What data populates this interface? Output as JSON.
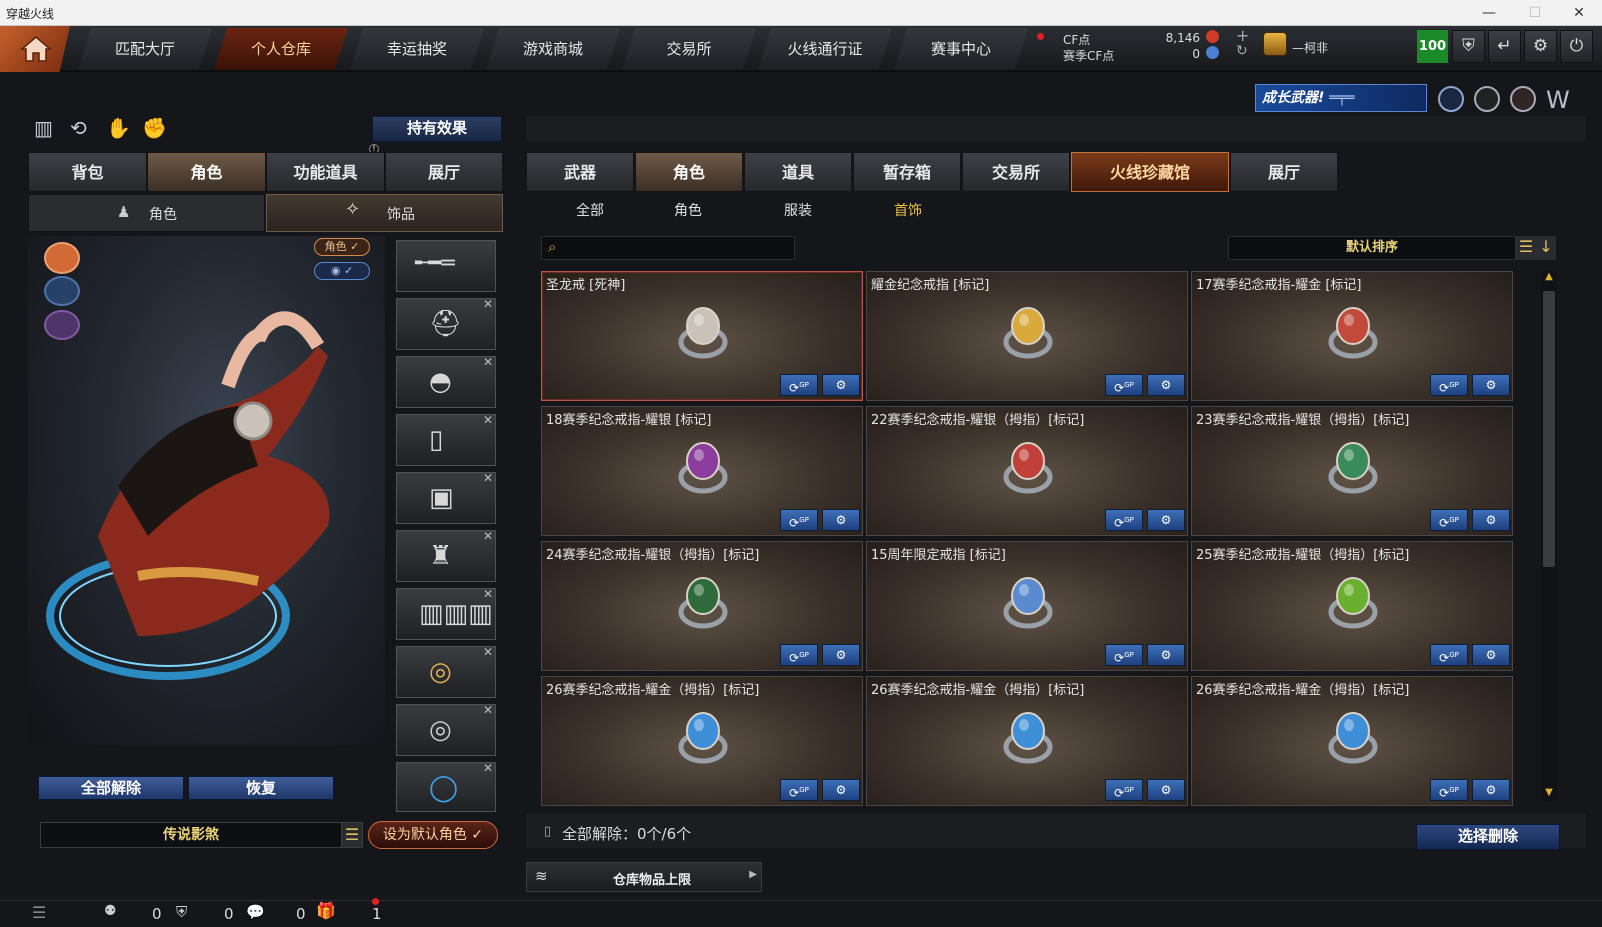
{
  "window": {
    "title": "穿越火线",
    "min": "—",
    "max": "☐",
    "close": "✕"
  },
  "topnav": {
    "tabs": [
      "匹配大厅",
      "个人仓库",
      "幸运抽奖",
      "游戏商城",
      "交易所",
      "火线通行证",
      "赛事中心"
    ],
    "cf_label": "CF点",
    "cf_value": "8,146",
    "season_label": "赛季CF点",
    "season_value": "0",
    "player_name": "—柯非",
    "level_badge": "100"
  },
  "promo": {
    "text": "成长武器!"
  },
  "left": {
    "hold_effect": "持有效果",
    "tabs": [
      "背包",
      "角色",
      "功能道具",
      "展厅"
    ],
    "subtabs": [
      "角色",
      "饰品"
    ],
    "chip_role": "角色 ✓",
    "chip_eye": "◉ ✓",
    "unequip_all": "全部解除",
    "restore": "恢复",
    "character_name": "传说影煞",
    "set_default": "设为默认角色 ✓"
  },
  "right": {
    "tabs": [
      "武器",
      "角色",
      "道具",
      "暂存箱",
      "交易所",
      "火线珍藏馆",
      "展厅"
    ],
    "subtabs": [
      "全部",
      "角色",
      "服装",
      "首饰"
    ],
    "search_placeholder": "",
    "sort": "默认排序",
    "items": [
      {
        "name": "圣龙戒 [死神]",
        "color": "#c9c2b8"
      },
      {
        "name": "耀金纪念戒指 [标记]",
        "color": "#d9a93b"
      },
      {
        "name": "17赛季纪念戒指-耀金 [标记]",
        "color": "#c14a3a"
      },
      {
        "name": "18赛季纪念戒指-耀银 [标记]",
        "color": "#8a3d9c"
      },
      {
        "name": "22赛季纪念戒指-耀银（拇指）[标记]",
        "color": "#c2403a"
      },
      {
        "name": "23赛季纪念戒指-耀银（拇指）[标记]",
        "color": "#3a8a5a"
      },
      {
        "name": "24赛季纪念戒指-耀银（拇指）[标记]",
        "color": "#2f6b3a"
      },
      {
        "name": "15周年限定戒指 [标记]",
        "color": "#5a8bd0"
      },
      {
        "name": "25赛季纪念戒指-耀银（拇指）[标记]",
        "color": "#6ab02f"
      },
      {
        "name": "26赛季纪念戒指-耀金（拇指）[标记]",
        "color": "#3f8fd8"
      },
      {
        "name": "26赛季纪念戒指-耀金（拇指）[标记]",
        "color": "#3f8fd8"
      },
      {
        "name": "26赛季纪念戒指-耀金（拇指）[标记]",
        "color": "#3f8fd8"
      }
    ],
    "gp_label": "GP",
    "unequip_status": "全部解除：0个/6个",
    "select_delete": "选择删除",
    "storage_limit": "仓库物品上限"
  },
  "bottom": {
    "counts": [
      "0",
      "0",
      "0",
      "1"
    ]
  }
}
